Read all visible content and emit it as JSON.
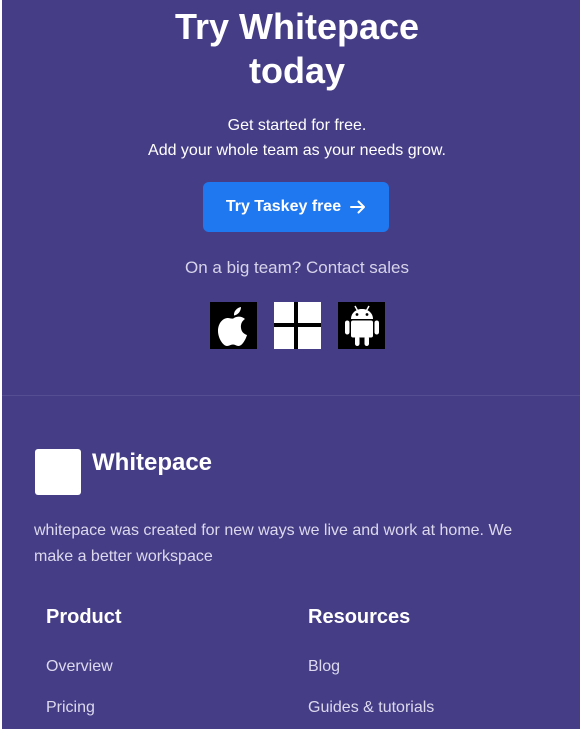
{
  "hero": {
    "title_line1": "Try Whitepace",
    "title_line2": "today",
    "subtitle_line1": "Get started for free.",
    "subtitle_line2": "Add your whole team as your needs grow.",
    "cta_label": "Try Taskey free",
    "contact_text": "On a big team? Contact sales",
    "platforms": [
      "apple-icon",
      "windows-icon",
      "android-icon"
    ]
  },
  "footer": {
    "brand_name": "Whitepace",
    "description": "whitepace was created for new ways we live and work at home. We make a better workspace",
    "columns": [
      {
        "title": "Product",
        "links": [
          "Overview",
          "Pricing"
        ]
      },
      {
        "title": "Resources",
        "links": [
          "Blog",
          "Guides & tutorials"
        ]
      }
    ]
  },
  "colors": {
    "background": "#453e86",
    "cta": "#1f78f0"
  }
}
